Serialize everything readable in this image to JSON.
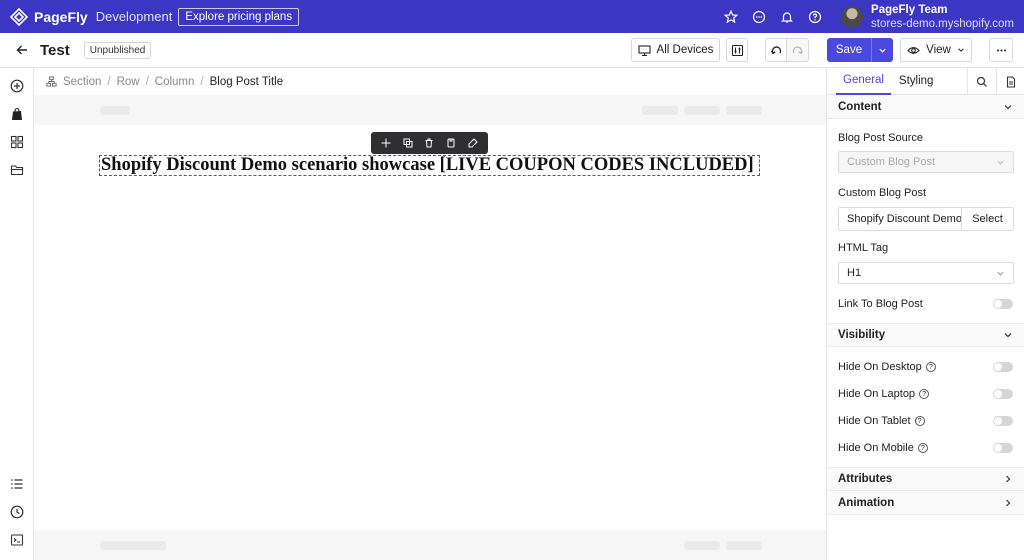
{
  "topbar": {
    "brand_name": "PageFly",
    "brand_env": "Development",
    "pricing_label": "Explore pricing plans",
    "icons": [
      "star-icon",
      "chat-icon",
      "bell-icon",
      "help-icon"
    ],
    "account_name": "PageFly Team",
    "account_store": "stores-demo.myshopify.com"
  },
  "toolbar": {
    "page_name": "Test",
    "status": "Unpublished",
    "devices_label": "All Devices",
    "save_label": "Save",
    "view_label": "View"
  },
  "breadcrumb": {
    "items": [
      "Section",
      "Row",
      "Column",
      "Blog Post Title"
    ],
    "separator": "/"
  },
  "canvas": {
    "heading": "Shopify Discount Demo scenario showcase [LIVE COUPON CODES INCLUDED]"
  },
  "panel": {
    "tabs": [
      "General",
      "Styling"
    ],
    "content_section": "Content",
    "blog_post_source_label": "Blog Post Source",
    "blog_post_source_value": "Custom Blog Post",
    "custom_blog_post_label": "Custom Blog Post",
    "custom_blog_post_value": "Shopify Discount Demo scenario showcase [LIVE COUPON CODES INCLUDED]",
    "select_label": "Select",
    "html_tag_label": "HTML Tag",
    "html_tag_value": "H1",
    "link_label": "Link To Blog Post",
    "link_enabled": false,
    "visibility_section": "Visibility",
    "visibility": [
      {
        "label": "Hide On Desktop",
        "enabled": false
      },
      {
        "label": "Hide On Laptop",
        "enabled": false
      },
      {
        "label": "Hide On Tablet",
        "enabled": false
      },
      {
        "label": "Hide On Mobile",
        "enabled": false
      }
    ],
    "attributes_section": "Attributes",
    "animation_section": "Animation"
  },
  "colors": {
    "brand": "#3b36c4",
    "accent": "#4b48dd"
  }
}
